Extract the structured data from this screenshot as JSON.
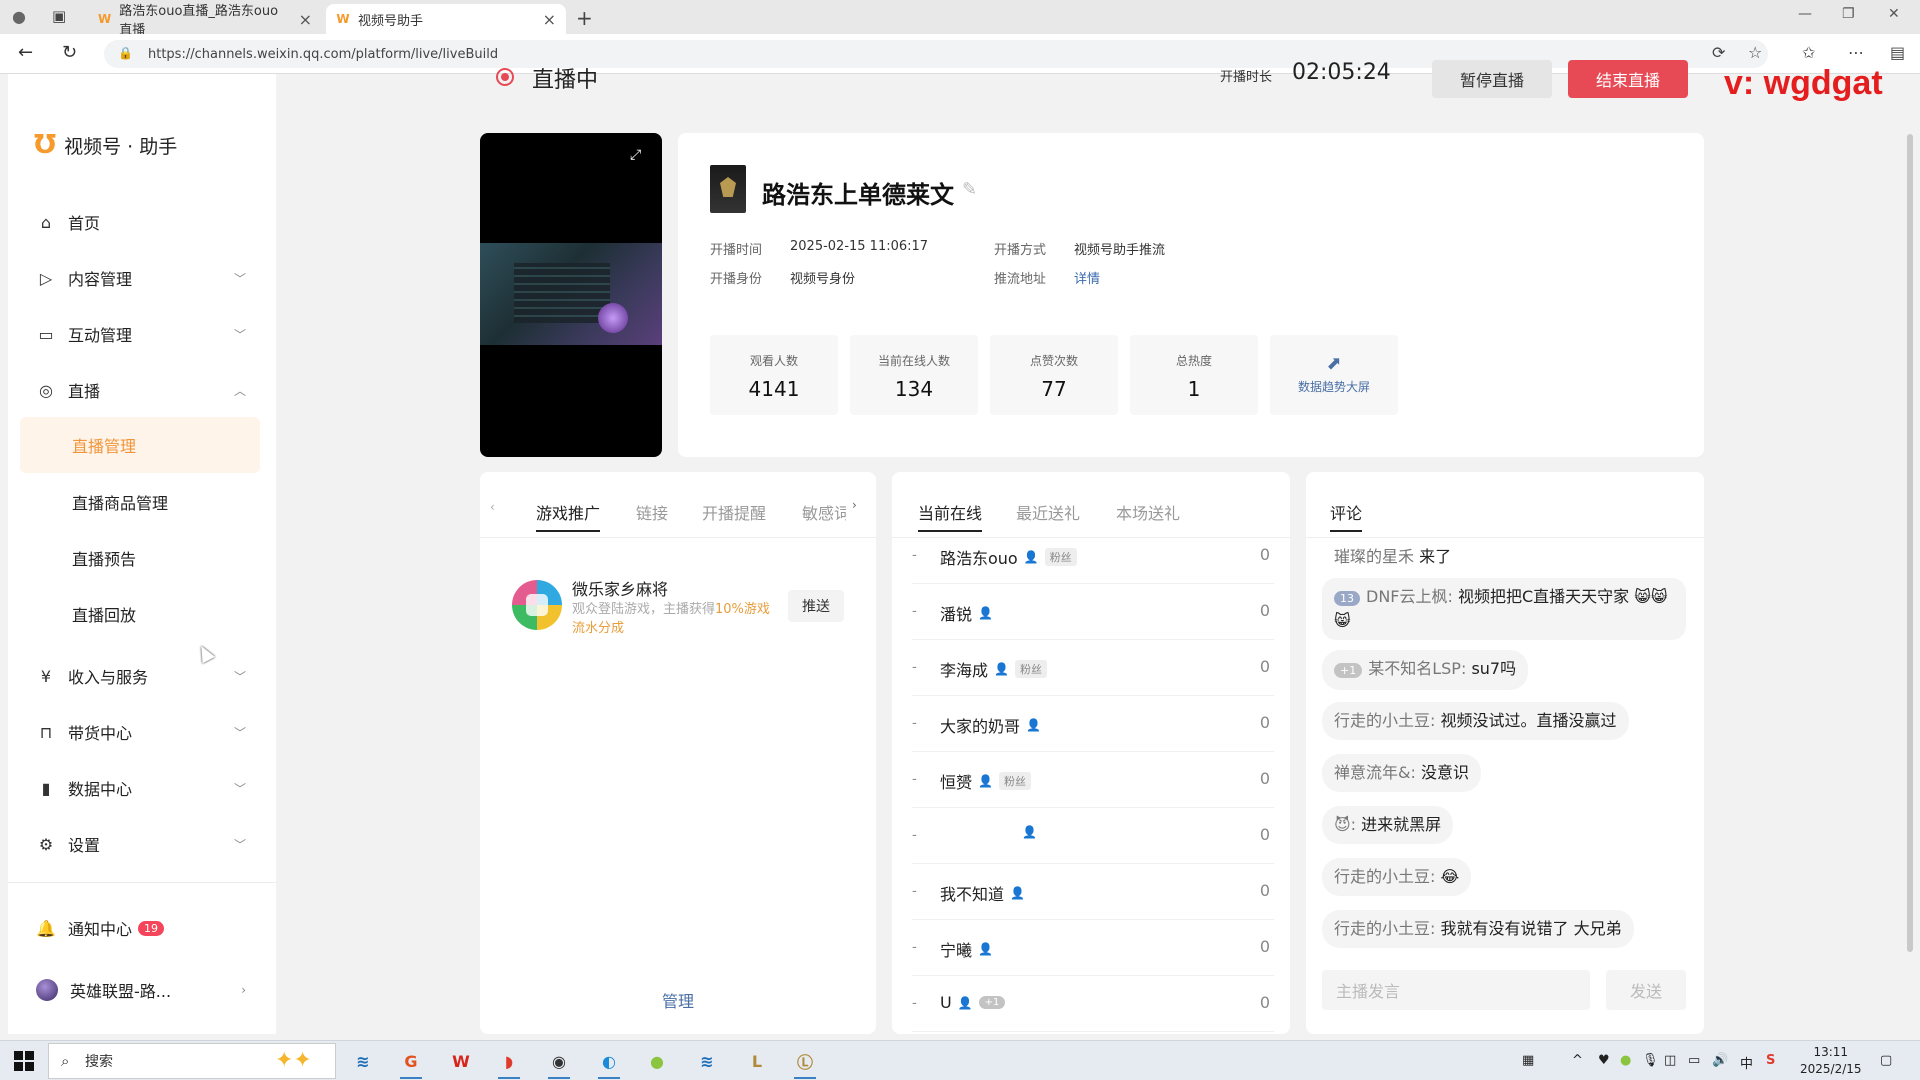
{
  "browser": {
    "tabs": [
      {
        "label": "路浩东ouo直播_路浩东ouo直播_"
      },
      {
        "label": "视频号助手"
      }
    ],
    "url": "https://channels.weixin.qq.com/platform/live/liveBuild"
  },
  "sidebar": {
    "logo_text": "视频号 · 助手",
    "items": [
      {
        "label": "首页",
        "icon": "home-icon"
      },
      {
        "label": "内容管理",
        "icon": "content-icon"
      },
      {
        "label": "互动管理",
        "icon": "comment-icon"
      },
      {
        "label": "直播",
        "icon": "live-icon"
      }
    ],
    "live_sub": [
      "直播管理",
      "直播商品管理",
      "直播预告",
      "直播回放"
    ],
    "items_after": [
      {
        "label": "收入与服务",
        "icon": "yen-icon"
      },
      {
        "label": "带货中心",
        "icon": "bag-icon"
      },
      {
        "label": "数据中心",
        "icon": "chart-icon"
      },
      {
        "label": "设置",
        "icon": "gear-icon"
      }
    ],
    "notify_label": "通知中心",
    "notify_count": "19",
    "account_label": "英雄联盟-路..."
  },
  "live": {
    "status": "直播中",
    "duration_label": "开播时长",
    "duration": "02:05:24",
    "pause_label": "暂停直播",
    "end_label": "结束直播"
  },
  "watermark": "v: wgdgat",
  "anchor": {
    "name": "路浩东上单德莱文",
    "start_time_label": "开播时间",
    "start_time": "2025-02-15 11:06:17",
    "identity_label": "开播身份",
    "identity": "视频号身份",
    "method_label": "开播方式",
    "method": "视频号助手推流",
    "push_label": "推流地址",
    "push_link": "详情"
  },
  "stats": [
    {
      "label": "观看人数",
      "value": "4141"
    },
    {
      "label": "当前在线人数",
      "value": "134"
    },
    {
      "label": "点赞次数",
      "value": "77"
    },
    {
      "label": "总热度",
      "value": "1"
    }
  ],
  "trend_label": "数据趋势大屏",
  "promo": {
    "tabs": [
      "游戏推广",
      "链接",
      "开播提醒",
      "敏感词"
    ],
    "game_name": "微乐家乡麻将",
    "desc_prefix": "观众登陆游戏，主播获得",
    "desc_highlight": "10%游戏流水分成",
    "push_label": "推送",
    "manage_label": "管理"
  },
  "viewers": {
    "tabs": [
      "当前在线",
      "最近送礼",
      "本场送礼"
    ],
    "list": [
      {
        "name": "路浩东ouo",
        "fan": "粉丝",
        "count": "0"
      },
      {
        "name": "潘锐",
        "fan": "",
        "count": "0"
      },
      {
        "name": "李海成",
        "fan": "粉丝",
        "count": "0"
      },
      {
        "name": "大家的奶哥",
        "fan": "",
        "count": "0"
      },
      {
        "name": "恒赟",
        "fan": "粉丝",
        "count": "0"
      },
      {
        "name": "",
        "fan": "",
        "count": "0"
      },
      {
        "name": "我不知道",
        "fan": "",
        "count": "0"
      },
      {
        "name": "宁曦",
        "fan": "",
        "count": "0"
      },
      {
        "name": "U",
        "fan": "",
        "level": "+1",
        "count": "0"
      }
    ]
  },
  "comments": {
    "tab": "评论",
    "list": [
      {
        "who": "璀璨的星禾",
        "text": "来了"
      },
      {
        "level": "13",
        "who": "DNF云上枫:",
        "text": "视频把把C直播天天守家 😸😸😸"
      },
      {
        "level": "+1",
        "who": "某不知名LSP:",
        "text": "su7吗"
      },
      {
        "who": "行走的小土豆:",
        "text": "视频没试过。直播没赢过"
      },
      {
        "who": "禅意流年&:",
        "text": "没意识"
      },
      {
        "who": "😈:",
        "text": "进来就黑屏"
      },
      {
        "who": "行走的小土豆:",
        "text": "😂"
      },
      {
        "who": "行走的小土豆:",
        "text": "我就有没有说错了 大兄弟"
      }
    ],
    "input_placeholder": "主播发言",
    "send_label": "发送"
  },
  "taskbar": {
    "search_label": "搜索",
    "time": "13:11",
    "date": "2025/2/15",
    "ime": "中"
  }
}
